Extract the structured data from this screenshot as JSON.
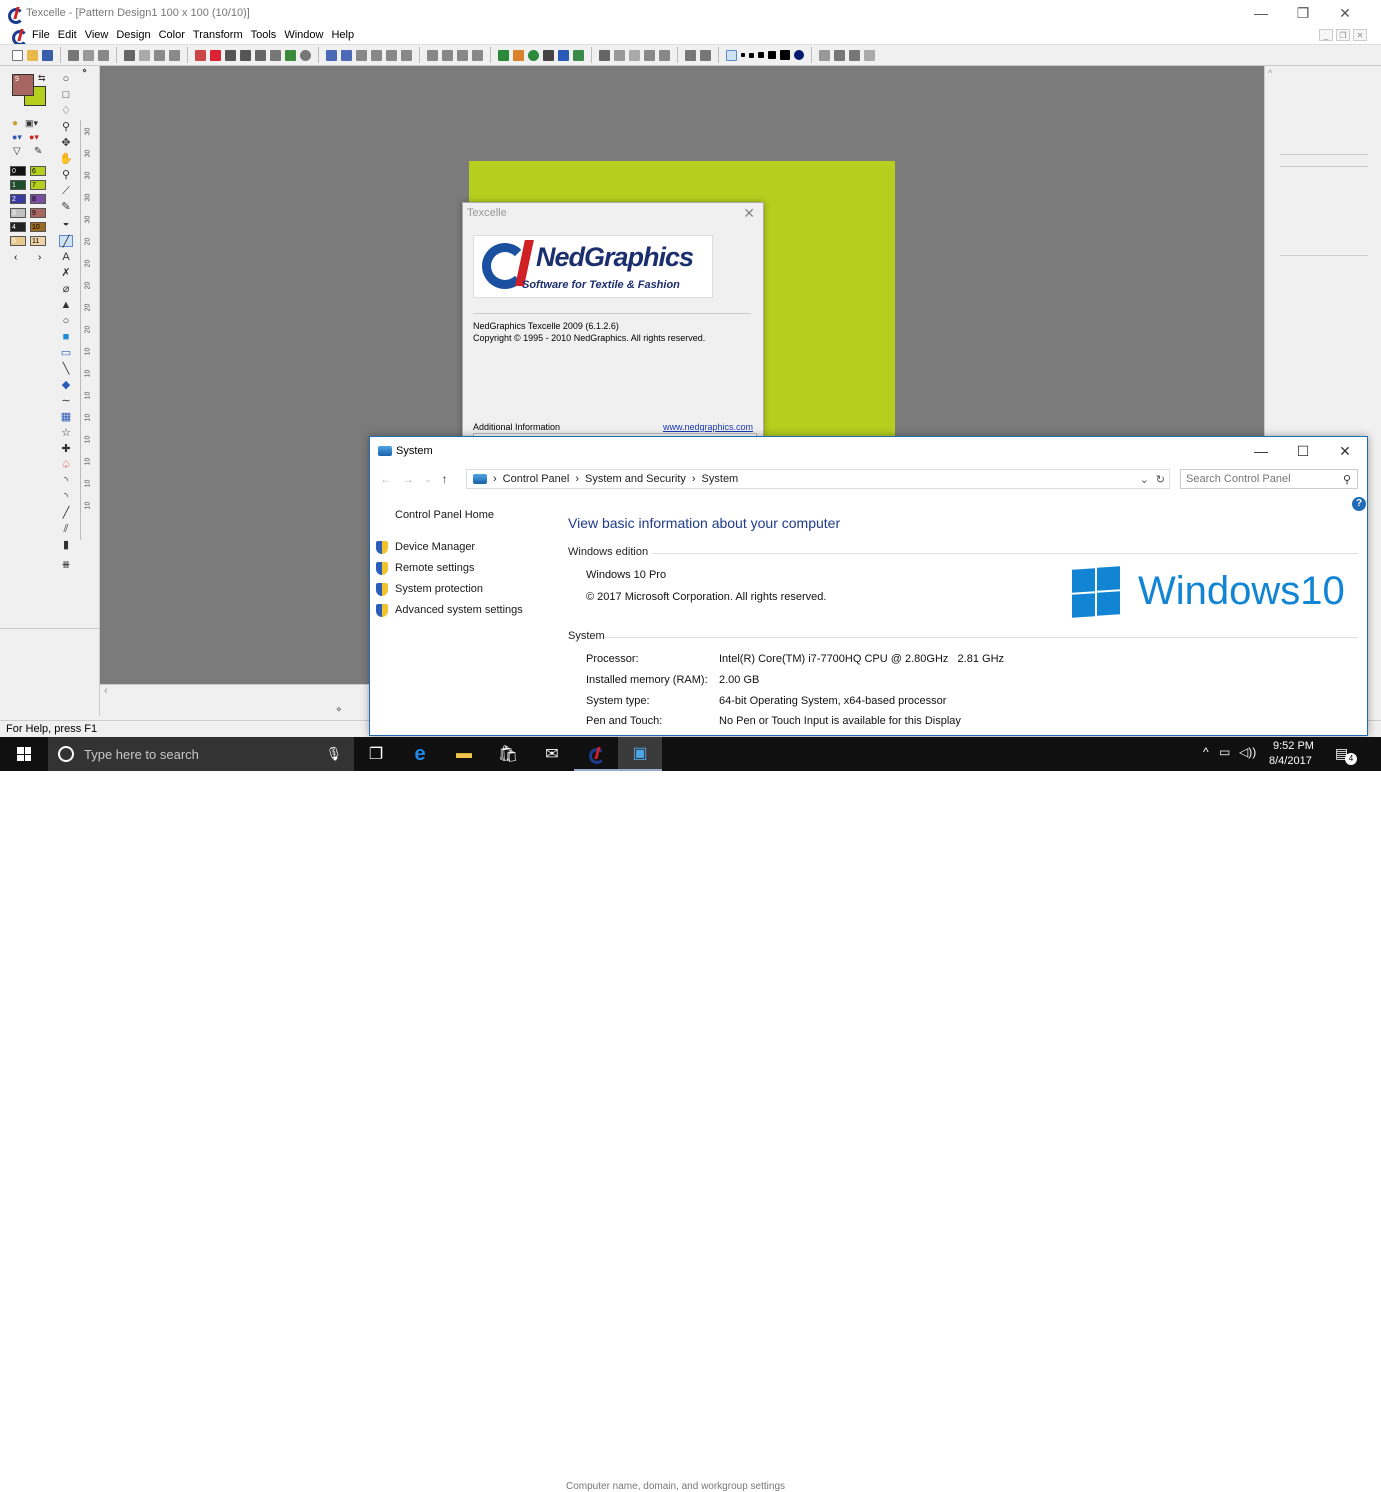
{
  "app": {
    "title": "Texcelle - [Pattern Design1 100 x 100 (10/10)]",
    "menu": [
      "File",
      "Edit",
      "View",
      "Design",
      "Color",
      "Transform",
      "Tools",
      "Window",
      "Help"
    ],
    "status_text": "For Help, press F1",
    "palette": [
      {
        "left": "0",
        "right": "6"
      },
      {
        "left": "1",
        "right": "7"
      },
      {
        "left": "2",
        "right": "8"
      },
      {
        "left": "3",
        "right": "9"
      },
      {
        "left": "4",
        "right": "10"
      },
      {
        "left": "5",
        "right": "11"
      }
    ],
    "palette_colors_left": [
      "#111111",
      "#1e4d2b",
      "#3a3aa0",
      "#c0c0c0",
      "#222222",
      "#e7c88c"
    ],
    "palette_colors_right": [
      "#b5cf1f",
      "#b5cf1f",
      "#7b4fa0",
      "#a86661",
      "#9c6a1f",
      "#f0d2a8"
    ],
    "foreground_color": "#a86661",
    "background_color": "#b5cf1f",
    "ruler_numbers": [
      "30",
      "30",
      "30",
      "30",
      "30",
      "20",
      "20",
      "20",
      "20",
      "20",
      "10",
      "10",
      "10",
      "10",
      "10",
      "10",
      "10",
      "10"
    ],
    "fg_swatch_number": "9"
  },
  "about": {
    "title": "Texcelle",
    "logo_name": "NedGraphics",
    "logo_tagline": "Software for Textile & Fashion",
    "version": "NedGraphics Texcelle 2009 (6.1.2.6)",
    "copyright": "Copyright © 1995 - 2010 NedGraphics. All rights reserved.",
    "additional_info": "Additional Information",
    "website": "www.nedgraphics.com"
  },
  "system": {
    "title": "System",
    "breadcrumb": [
      "Control Panel",
      "System and Security",
      "System"
    ],
    "search_placeholder": "Search Control Panel",
    "sidebar": {
      "home": "Control Panel Home",
      "links": [
        "Device Manager",
        "Remote settings",
        "System protection",
        "Advanced system settings"
      ]
    },
    "heading": "View basic information about your computer",
    "edition_label": "Windows edition",
    "edition": "Windows 10 Pro",
    "edition_copyright": "© 2017 Microsoft Corporation. All rights reserved.",
    "windows_logo_text": "Windows10",
    "system_label": "System",
    "specs": [
      {
        "label": "Processor:",
        "value": "Intel(R) Core(TM) i7-7700HQ CPU @ 2.80GHz   2.81 GHz"
      },
      {
        "label": "Installed memory (RAM):",
        "value": "2.00 GB"
      },
      {
        "label": "System type:",
        "value": "64-bit Operating System, x64-based processor"
      },
      {
        "label": "Pen and Touch:",
        "value": "No Pen or Touch Input is available for this Display"
      }
    ],
    "partial_section": "Computer name, domain, and workgroup settings"
  },
  "taskbar": {
    "search_placeholder": "Type here to search",
    "time": "9:52 PM",
    "date": "8/4/2017",
    "notification_count": "4"
  }
}
